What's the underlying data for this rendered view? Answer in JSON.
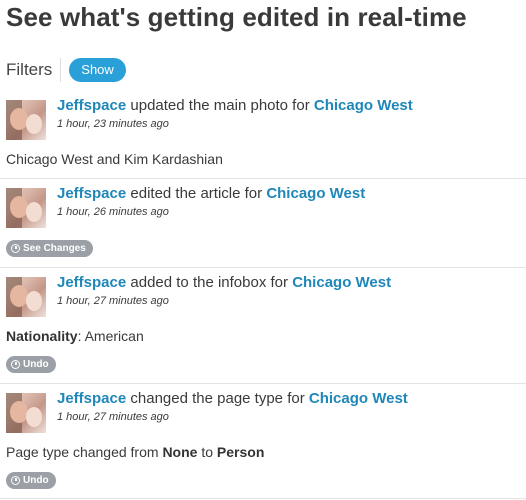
{
  "page": {
    "title": "See what's getting edited in real-time",
    "filters_label": "Filters",
    "show_button": "Show"
  },
  "items": [
    {
      "user": "Jeffspace",
      "action": "updated the main photo for",
      "page": "Chicago West",
      "time": "1 hour, 23 minutes ago",
      "detail": "Chicago West and Kim Kardashian"
    },
    {
      "user": "Jeffspace",
      "action": "edited the article for",
      "page": "Chicago West",
      "time": "1 hour, 26 minutes ago",
      "button": "See Changes"
    },
    {
      "user": "Jeffspace",
      "action": "added to the infobox for",
      "page": "Chicago West",
      "time": "1 hour, 27 minutes ago",
      "detail_key": "Nationality",
      "detail_value": "American",
      "button": "Undo"
    },
    {
      "user": "Jeffspace",
      "action": "changed the page type for",
      "page": "Chicago West",
      "time": "1 hour, 27 minutes ago",
      "detail_prefix": "Page type changed from",
      "detail_from": "None",
      "detail_to_word": "to",
      "detail_to": "Person",
      "button": "Undo"
    }
  ],
  "colors": {
    "link": "#1f87b9",
    "show_button": "#2aa0d8",
    "pill": "#9aa0a6"
  },
  "icons": {
    "pill_icon": "history-icon"
  }
}
